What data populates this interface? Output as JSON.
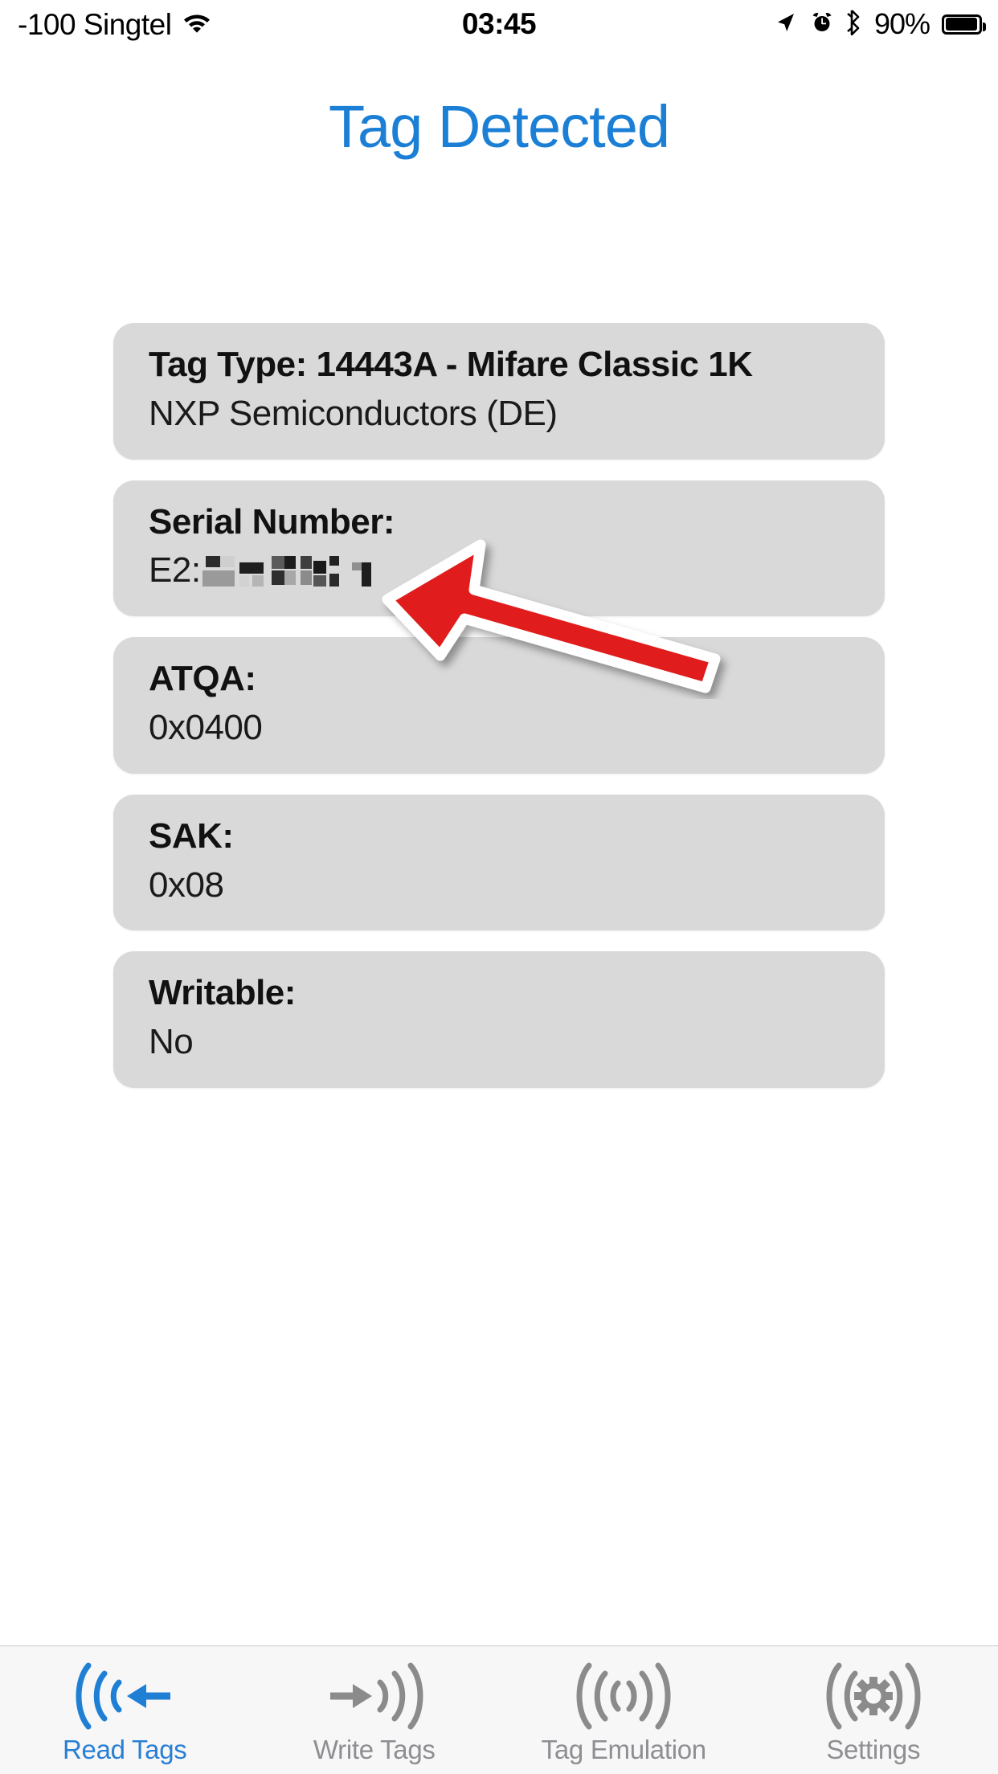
{
  "status_bar": {
    "carrier": "-100 Singtel",
    "wifi_icon": "wifi-icon",
    "clock": "03:45",
    "location_icon": "location-arrow-icon",
    "alarm_icon": "alarm-clock-icon",
    "bluetooth_icon": "bluetooth-icon",
    "battery_percent": "90%",
    "battery_level": 90
  },
  "header": {
    "title": "Tag Detected",
    "title_color": "#1b7fd6"
  },
  "cards": [
    {
      "name": "tag-type",
      "title": "Tag Type: 14443A - Mifare Classic 1K",
      "value": "NXP Semiconductors (DE)"
    },
    {
      "name": "serial-number",
      "title": "Serial Number:",
      "value": "E2:",
      "redacted": true
    },
    {
      "name": "atqa",
      "title": "ATQA:",
      "value": "0x0400"
    },
    {
      "name": "sak",
      "title": "SAK:",
      "value": "0x08"
    },
    {
      "name": "writable",
      "title": "Writable:",
      "value": "No"
    }
  ],
  "annotation": {
    "type": "arrow",
    "color": "#e01b1b",
    "outline_color": "#ffffff",
    "points_to": "serial-number-value"
  },
  "tab_bar": {
    "active_index": 0,
    "active_color": "#2a7fd4",
    "inactive_color": "#8e8e93",
    "tabs": [
      {
        "label": "Read Tags",
        "icon": "nfc-read-icon"
      },
      {
        "label": "Write Tags",
        "icon": "nfc-write-icon"
      },
      {
        "label": "Tag Emulation",
        "icon": "nfc-emulation-icon"
      },
      {
        "label": "Settings",
        "icon": "nfc-settings-gear-icon"
      }
    ]
  },
  "theme": {
    "card_bg": "#d9d9d9",
    "page_bg": "#ffffff",
    "tabbar_bg": "#f7f7f7"
  }
}
